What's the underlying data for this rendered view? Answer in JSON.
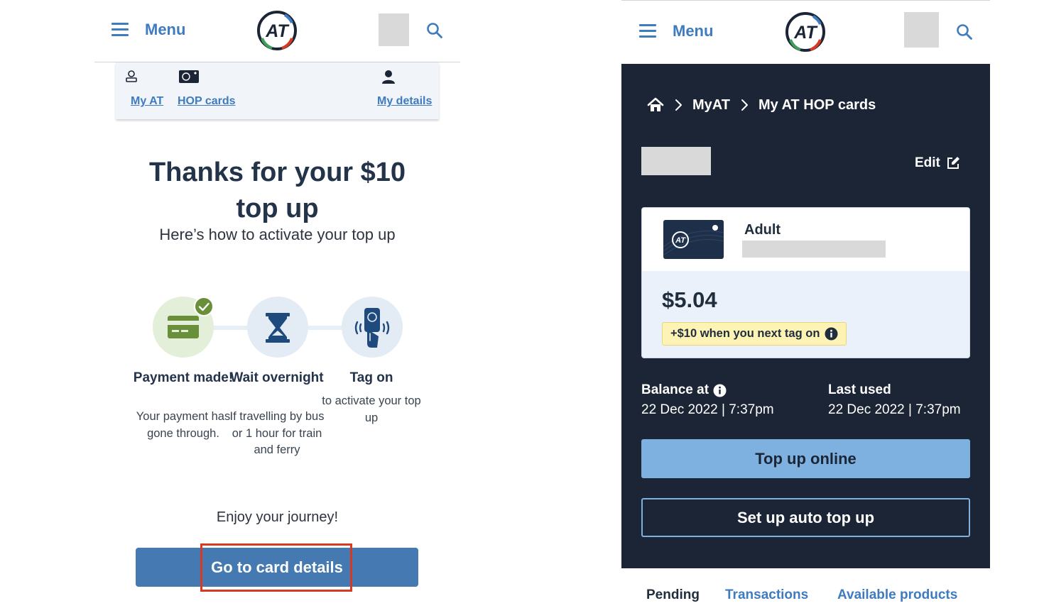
{
  "left_screen": {
    "header": {
      "menu_label": "Menu",
      "logo_text": "AT"
    },
    "subnav": [
      {
        "label": "My AT"
      },
      {
        "label": "HOP cards"
      },
      {
        "label": "My details"
      }
    ],
    "title_line1": "Thanks for your $10",
    "title_line2": "top up",
    "subtitle": "Here’s how to activate your top up",
    "steps": [
      {
        "title": "Payment made!",
        "desc": "Your payment has gone through.",
        "icon": "credit-card-icon",
        "done": true
      },
      {
        "title": "Wait overnight",
        "desc": "If travelling by bus or 1 hour for train and ferry",
        "icon": "hourglass-icon",
        "done": false
      },
      {
        "title": "Tag on",
        "desc": "to activate your top up",
        "icon": "tag-on-card-icon",
        "done": false
      }
    ],
    "enjoy": "Enjoy your journey!",
    "cta_label": "Go to card details"
  },
  "right_screen": {
    "header": {
      "menu_label": "Menu",
      "logo_text": "AT"
    },
    "breadcrumb": [
      "MyAT",
      "My AT HOP cards"
    ],
    "edit_label": "Edit",
    "card": {
      "type": "Adult",
      "balance": "$5.04",
      "pending_note": "+$10 when you next tag on"
    },
    "balance_at_label": "Balance at",
    "balance_at_value": "22 Dec 2022 | 7:37pm",
    "last_used_label": "Last used",
    "last_used_value": "22 Dec 2022 | 7:37pm",
    "primary_button": "Top up online",
    "secondary_button": "Set up auto top up",
    "tabs": [
      "Pending",
      "Transactions",
      "Available products"
    ]
  },
  "colors": {
    "brand_blue": "#3e7bbf",
    "button_blue": "#4479b1",
    "dark_panel": "#1b2535",
    "light_button": "#7eb1e0",
    "success_green": "#6a8f3a",
    "highlight_red": "#d63a24"
  }
}
